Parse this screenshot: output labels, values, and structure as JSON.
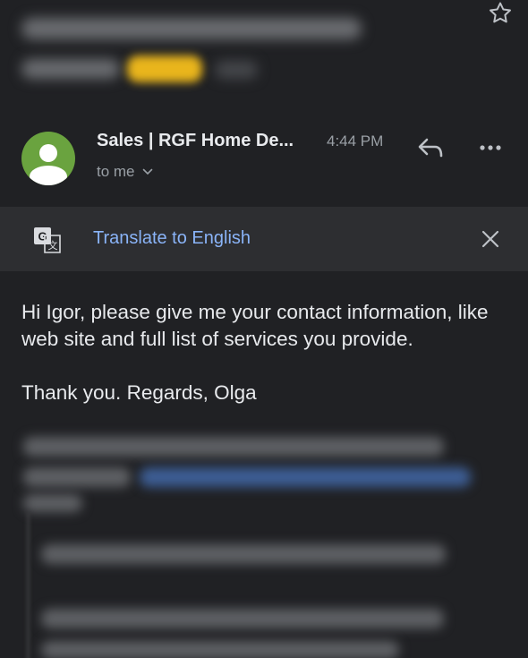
{
  "email": {
    "sender": "Sales | RGF Home De...",
    "time": "4:44 PM",
    "recipient": "to me",
    "avatar_color": "#6aa33f"
  },
  "translate": {
    "link_label": "Translate to English"
  },
  "message": {
    "lines": [
      "Hi Igor, please give me your contact information, like web site and full list of services you provide.",
      "Thank you. Regards, Olga"
    ]
  },
  "icons": {
    "star": "star-icon",
    "reply": "reply-icon",
    "more": "more-options-icon",
    "translate": "translate-icon",
    "close": "close-icon",
    "chevron": "chevron-down-icon",
    "avatar": "person-icon"
  },
  "colors": {
    "background": "#202124",
    "translate_bar": "#2d2e31",
    "link": "#8ab4f8",
    "label_yellow": "#e9b51c"
  }
}
